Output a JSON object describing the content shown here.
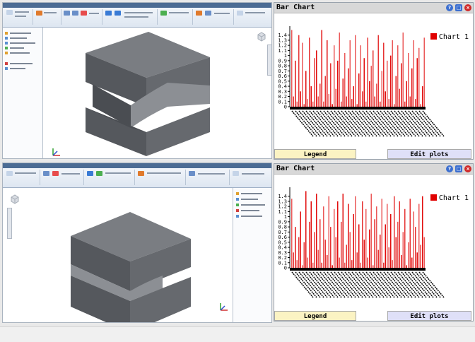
{
  "panels": [
    {
      "title": "Bar Chart",
      "legend_button": "Legend",
      "edit_button": "Edit plots",
      "chart_data": {
        "type": "bar",
        "y_ticks": [
          "0",
          "0.1",
          "0.2",
          "0.3",
          "0.4",
          "0.5",
          "0.6",
          "0.7",
          "0.8",
          "0.9",
          "1",
          "1.1",
          "1.2",
          "1.3",
          "1.4"
        ],
        "ylim": [
          0,
          1.52
        ],
        "series": [
          {
            "name": "Chart 1",
            "color": "#e00000",
            "values": [
              1.5,
              0.2,
              0.9,
              0.1,
              1.4,
              0.3,
              1.25,
              0.05,
              0.7,
              0.15,
              1.35,
              0.4,
              0.1,
              0.95,
              1.1,
              0.2,
              0.45,
              1.5,
              0.1,
              0.6,
              1.3,
              0.25,
              0.85,
              0.05,
              1.2,
              0.35,
              0.9,
              1.45,
              0.1,
              0.55,
              1.05,
              0.2,
              0.75,
              1.3,
              0.15,
              0.4,
              1.4,
              0.05,
              0.65,
              1.2,
              0.3,
              0.95,
              0.1,
              1.35,
              0.5,
              0.8,
              1.1,
              0.2,
              0.45,
              1.4,
              0.1,
              0.7,
              1.25,
              0.3,
              0.9,
              0.15,
              1.0,
              1.3,
              0.05,
              0.6,
              1.2,
              0.35,
              0.85,
              1.45,
              0.1,
              0.5,
              1.05,
              0.2,
              0.75,
              1.3,
              0.15,
              0.95,
              1.15,
              0.05,
              0.4,
              1.35
            ]
          }
        ]
      }
    },
    {
      "title": "Bar Chart",
      "legend_button": "Legend",
      "edit_button": "Edit plots",
      "chart_data": {
        "type": "bar",
        "y_ticks": [
          "0",
          "0.1",
          "0.2",
          "0.3",
          "0.4",
          "0.5",
          "0.6",
          "0.7",
          "0.8",
          "0.9",
          "1",
          "1.1",
          "1.2",
          "1.3",
          "1.4"
        ],
        "ylim": [
          0,
          1.52
        ],
        "series": [
          {
            "name": "Chart 1",
            "color": "#e00000",
            "values": [
              1.35,
              0.3,
              0.8,
              0.15,
              0.6,
              1.1,
              0.05,
              0.5,
              1.5,
              0.2,
              0.9,
              1.3,
              0.1,
              0.7,
              1.45,
              0.35,
              0.95,
              0.1,
              1.2,
              0.55,
              0.25,
              1.4,
              0.8,
              0.05,
              1.15,
              0.6,
              1.3,
              0.2,
              0.9,
              1.45,
              0.1,
              0.45,
              1.25,
              0.7,
              0.15,
              1.05,
              1.4,
              0.3,
              0.85,
              0.1,
              1.3,
              0.55,
              1.15,
              0.2,
              0.75,
              1.45,
              0.05,
              0.95,
              1.2,
              0.35,
              0.65,
              1.35,
              0.1,
              0.85,
              1.25,
              0.4,
              1.05,
              0.15,
              1.4,
              0.6,
              0.9,
              1.3,
              0.25,
              0.7,
              1.15,
              0.05,
              0.5,
              1.35,
              0.2,
              1.1,
              0.8,
              0.3,
              1.25,
              0.45,
              1.4,
              0.6
            ]
          }
        ]
      }
    }
  ],
  "colors": {
    "window_title_bar": "#d8d8d8",
    "legend_button_bg": "#fbf3c3",
    "edit_button_bg": "#dfe0f8",
    "cad_ribbon_top": "#4c6c94",
    "part_shade_top": "#7a7d82",
    "part_shade_front": "#55585d",
    "part_shade_side": "#66696e"
  }
}
